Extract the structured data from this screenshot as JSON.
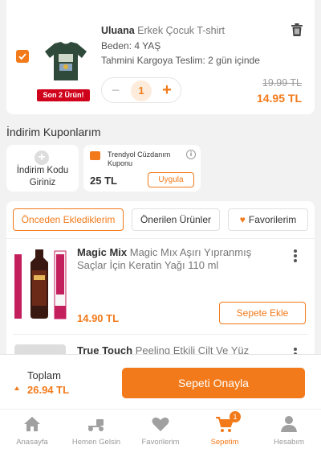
{
  "cart_item": {
    "brand": "Uluana",
    "name": "Erkek Çocuk T-shirt",
    "size": "Beden: 4 YAŞ",
    "delivery": "Tahmini Kargoya Teslim: 2 gün içinde",
    "badge": "Son 2 Ürün!",
    "quantity": "1",
    "qty_minus": "−",
    "qty_plus": "+",
    "old_price": "19.99 TL",
    "new_price": "14.95 TL",
    "checked": true
  },
  "coupons": {
    "section_title": "İndirim Kuponlarım",
    "add_label": "İndirim Kodu Giriniz",
    "wallet": {
      "title": "Trendyol Cüzdanım Kuponu",
      "amount": "25 TL",
      "button": "Uygula"
    }
  },
  "recommendations": {
    "tabs": [
      "Önceden Eklediklerim",
      "Önerilen Ürünler",
      "Favorilerim"
    ],
    "active_tab": 0,
    "items": [
      {
        "brand": "Magic Mix",
        "name": "Magic Mıx Aşırı Yıpranmış Saçlar İçin Keratin Yağı 110 ml",
        "price": "14.90 TL",
        "button": "Sepete Ekle"
      },
      {
        "brand": "True Touch",
        "name": "Peeling Etkili Cilt Ve Yüz"
      }
    ]
  },
  "summary": {
    "total_label": "Toplam",
    "total_value": "26.94 TL",
    "confirm_button": "Sepeti Onayla"
  },
  "tabbar": {
    "items": [
      {
        "label": "Anasayfa",
        "icon": "home-icon"
      },
      {
        "label": "Hemen Gelsin",
        "icon": "scooter-icon"
      },
      {
        "label": "Favorilerim",
        "icon": "heart-icon"
      },
      {
        "label": "Sepetim",
        "icon": "cart-icon",
        "badge": "1",
        "active": true
      },
      {
        "label": "Hesabım",
        "icon": "user-icon"
      }
    ]
  },
  "colors": {
    "accent": "#f27a1a",
    "badge_red": "#d0021b"
  }
}
